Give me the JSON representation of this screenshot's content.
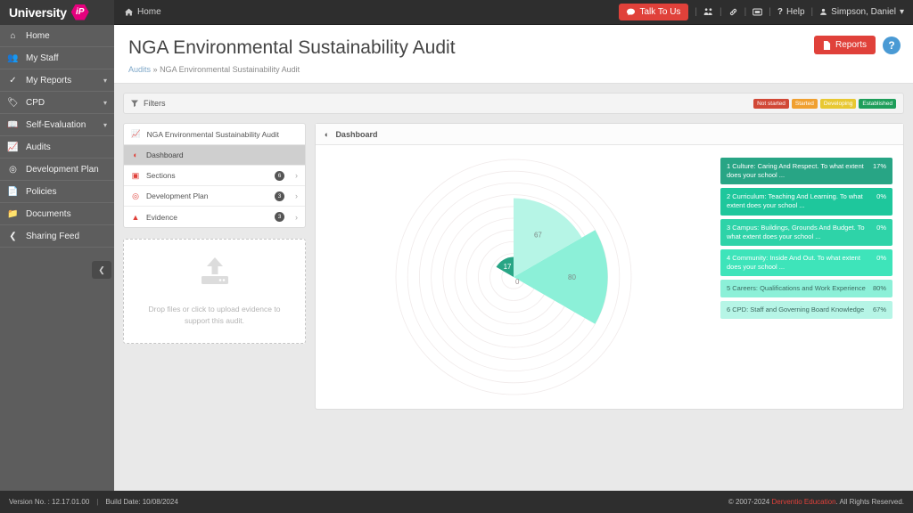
{
  "topbar": {
    "brand_name": "University",
    "brand_badge": "iP",
    "home_label": "Home",
    "home_icon": "home-icon",
    "talk_to_us": "Talk To Us",
    "talk_icon": "chat-bubble-icon",
    "icons": [
      {
        "name": "users-group-icon",
        "glyph": "$"
      },
      {
        "name": "link-icon",
        "glyph": "%"
      },
      {
        "name": "inbox-icon",
        "glyph": "&"
      }
    ],
    "help_label": "Help",
    "help_icon": "question-mark-icon",
    "user_name": "Simpson, Daniel",
    "user_icon": "user-icon",
    "caret": "▾",
    "separator": "|"
  },
  "sidebar": {
    "items": [
      {
        "label": "Home",
        "icon": "home-icon",
        "chevron": false
      },
      {
        "label": "My Staff",
        "icon": "users-icon",
        "chevron": false
      },
      {
        "label": "My Reports",
        "icon": "check-icon",
        "chevron": true
      },
      {
        "label": "CPD",
        "icon": "tag-icon",
        "chevron": true
      },
      {
        "label": "Self-Evaluation",
        "icon": "book-icon",
        "chevron": true
      },
      {
        "label": "Audits",
        "icon": "chart-line-icon",
        "chevron": false
      },
      {
        "label": "Development Plan",
        "icon": "target-icon",
        "chevron": false
      },
      {
        "label": "Policies",
        "icon": "document-icon",
        "chevron": false
      },
      {
        "label": "Documents",
        "icon": "folder-icon",
        "chevron": false
      },
      {
        "label": "Sharing Feed",
        "icon": "share-icon",
        "chevron": false
      }
    ],
    "collapse_icon": "chevron-left-icon"
  },
  "page": {
    "title": "NGA Environmental Sustainability Audit",
    "breadcrumb_parent": "Audits",
    "breadcrumb_sep": "»",
    "breadcrumb_current": "NGA Environmental Sustainability Audit",
    "reports_label": "Reports",
    "reports_icon": "file-icon",
    "help_icon": "question-circle-icon",
    "help_glyph": "?"
  },
  "filters": {
    "label": "Filters",
    "icon": "funnel-icon",
    "statuses": [
      {
        "label": "Not started",
        "color": "#d14836"
      },
      {
        "label": "Started",
        "color": "#f0a030"
      },
      {
        "label": "Developing",
        "color": "#e8c832"
      },
      {
        "label": "Established",
        "color": "#1e9e5a"
      }
    ]
  },
  "audit_menu": {
    "header": {
      "label": "NGA Environmental Sustainability Audit",
      "icon": "chart-line-icon"
    },
    "items": [
      {
        "label": "Dashboard",
        "icon": "pie-chart-icon",
        "badge": null,
        "chevron": false,
        "active": true
      },
      {
        "label": "Sections",
        "icon": "list-icon",
        "badge": "6",
        "chevron": true,
        "active": false
      },
      {
        "label": "Development Plan",
        "icon": "target-icon",
        "badge": "3",
        "chevron": true,
        "active": false
      },
      {
        "label": "Evidence",
        "icon": "upload-icon",
        "badge": "3",
        "chevron": true,
        "active": false
      }
    ],
    "chevron_glyph": "›"
  },
  "dropzone": {
    "icon": "upload-cloud-icon",
    "text": "Drop files or click to upload evidence to support this audit."
  },
  "dashboard": {
    "title": "Dashboard",
    "icon": "pie-chart-icon"
  },
  "chart_data": {
    "type": "pie",
    "title": "Dashboard",
    "subtitle": "",
    "xlabel": "",
    "ylabel": "",
    "grid": true,
    "legend_position": "right",
    "value_unit": "%",
    "rmax": 100,
    "rings": 10,
    "categories": [
      "1 Culture: Caring And Respect. To what extent does your school ...",
      "2 Curriculum: Teaching And Learning. To what extent does your school ...",
      "3 Campus: Buildings, Grounds And Budget. To what extent does your school ...",
      "4 Community: Inside And Out. To what extent does your school ...",
      "5 Careers: Qualifications and Work Experience",
      "6 CPD: Staff and Governing Board Knowledge"
    ],
    "values": [
      17,
      0,
      0,
      0,
      80,
      67
    ],
    "labels": [
      "17",
      "0",
      "0",
      "0",
      "80",
      "67"
    ],
    "percent_labels": [
      "17%",
      "0%",
      "0%",
      "0%",
      "80%",
      "67%"
    ],
    "colors": [
      "#28a585",
      "#1ec79c",
      "#2ed3a8",
      "#3ee4ba",
      "#8cf0d8",
      "#b6f5e6"
    ],
    "text_colors": [
      "#ffffff",
      "#ffffff",
      "#ffffff",
      "#ffffff",
      "#3c6a60",
      "#3c6a60"
    ]
  },
  "footer": {
    "version_label": "Version No. : 12.17.01.00",
    "separator": "|",
    "build_label": "Build Date: 10/08/2024",
    "copyright_prefix": "© 2007-2024 ",
    "copyright_link": "Derventio Education",
    "copyright_suffix": ". All Rights Reserved."
  }
}
